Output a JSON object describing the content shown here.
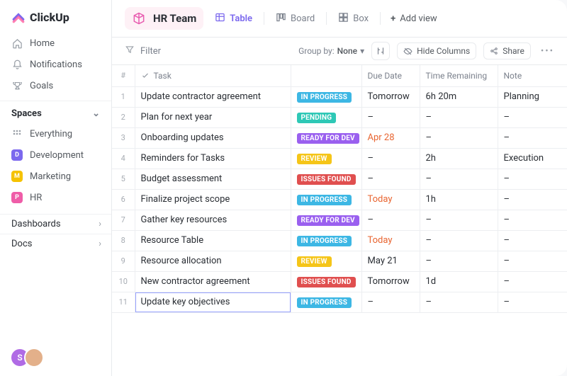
{
  "brand": "ClickUp",
  "sidebar": {
    "nav": [
      {
        "icon": "home",
        "label": "Home"
      },
      {
        "icon": "bell",
        "label": "Notifications"
      },
      {
        "icon": "trophy",
        "label": "Goals"
      }
    ],
    "spaces_header": "Spaces",
    "everything_label": "Everything",
    "spaces": [
      {
        "initial": "D",
        "label": "Development",
        "color": "#7b68ee"
      },
      {
        "initial": "M",
        "label": "Marketing",
        "color": "#f5c200"
      },
      {
        "initial": "P",
        "label": "HR",
        "color": "#ef5da8"
      }
    ],
    "dashboards_label": "Dashboards",
    "docs_label": "Docs"
  },
  "avatars": [
    {
      "text": "S",
      "bg": "#b06be5"
    },
    {
      "text": "",
      "bg": "#e3b08a"
    }
  ],
  "header": {
    "space_name": "HR Team",
    "views": [
      {
        "id": "table",
        "label": "Table",
        "active": true
      },
      {
        "id": "board",
        "label": "Board",
        "active": false
      },
      {
        "id": "box",
        "label": "Box",
        "active": false
      }
    ],
    "add_view": "Add view"
  },
  "toolbar": {
    "filter": "Filter",
    "group_by_prefix": "Group by:",
    "group_by_value": "None",
    "hide_columns": "Hide Columns",
    "share": "Share"
  },
  "columns": {
    "num": "#",
    "task": "Task",
    "due": "Due Date",
    "time": "Time Remaining",
    "note": "Note"
  },
  "status_colors": {
    "IN PROGRESS": "#3db7e4",
    "PENDING": "#2ec8b6",
    "READY FOR DEV": "#9a60ef",
    "REVIEW": "#f5c518",
    "ISSUES FOUND": "#e04f4f"
  },
  "rows": [
    {
      "n": 1,
      "task": "Update contractor agreement",
      "status": "IN PROGRESS",
      "due": "Tomorrow",
      "due_hot": false,
      "time": "6h 20m",
      "note": "Planning"
    },
    {
      "n": 2,
      "task": "Plan for next year",
      "status": "PENDING",
      "due": "–",
      "due_hot": false,
      "time": "–",
      "note": "–"
    },
    {
      "n": 3,
      "task": "Onboarding updates",
      "status": "READY FOR DEV",
      "due": "Apr 28",
      "due_hot": true,
      "time": "–",
      "note": "–"
    },
    {
      "n": 4,
      "task": "Reminders for Tasks",
      "status": "REVIEW",
      "due": "–",
      "due_hot": false,
      "time": "2h",
      "note": "Execution"
    },
    {
      "n": 5,
      "task": "Budget assessment",
      "status": "ISSUES FOUND",
      "due": "–",
      "due_hot": false,
      "time": "–",
      "note": "–"
    },
    {
      "n": 6,
      "task": "Finalize project scope",
      "status": "IN PROGRESS",
      "due": "Today",
      "due_hot": true,
      "time": "1h",
      "note": "–"
    },
    {
      "n": 7,
      "task": "Gather key resources",
      "status": "READY FOR DEV",
      "due": "–",
      "due_hot": false,
      "time": "–",
      "note": "–"
    },
    {
      "n": 8,
      "task": "Resource Table",
      "status": "IN PROGRESS",
      "due": "Today",
      "due_hot": true,
      "time": "–",
      "note": "–"
    },
    {
      "n": 9,
      "task": "Resource allocation",
      "status": "REVIEW",
      "due": "May 21",
      "due_hot": false,
      "time": "–",
      "note": "–"
    },
    {
      "n": 10,
      "task": "New contractor agreement",
      "status": "ISSUES FOUND",
      "due": "Tomorrow",
      "due_hot": false,
      "time": "1d",
      "note": "–"
    },
    {
      "n": 11,
      "task": "Update key objectives",
      "status": "IN PROGRESS",
      "due": "–",
      "due_hot": false,
      "time": "–",
      "note": "–",
      "editing": true
    }
  ]
}
